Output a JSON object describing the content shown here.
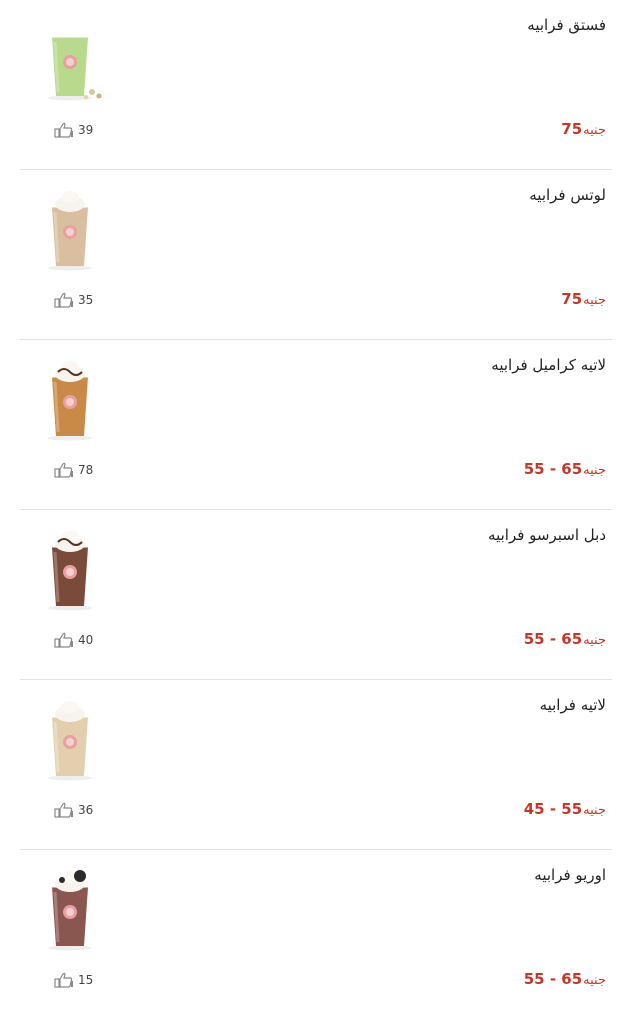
{
  "products": [
    {
      "name": "فستق فرابيه",
      "price_text": "75",
      "currency": "جنيه",
      "likes": "39",
      "image_icon": "pistachio-frappe-cup",
      "cup_color": "#b9d98d",
      "topping": "none"
    },
    {
      "name": "لوتس فرابيه",
      "price_text": "75",
      "currency": "جنيه",
      "likes": "35",
      "image_icon": "lotus-frappe-cup",
      "cup_color": "#d9bfa0",
      "topping": "cream"
    },
    {
      "name": "لاتيه كراميل فرابيه",
      "price_text": "55 - 65",
      "currency": "جنيه",
      "likes": "78",
      "image_icon": "caramel-latte-frappe-cup",
      "cup_color": "#c98a48",
      "topping": "cream-drizzle"
    },
    {
      "name": "دبل اسبرسو فرابيه",
      "price_text": "55 - 65",
      "currency": "جنيه",
      "likes": "40",
      "image_icon": "double-espresso-frappe-cup",
      "cup_color": "#7a4a3b",
      "topping": "cream-chocolate"
    },
    {
      "name": "لاتيه فرابيه",
      "price_text": "45 - 55",
      "currency": "جنيه",
      "likes": "36",
      "image_icon": "latte-frappe-cup",
      "cup_color": "#e3cfae",
      "topping": "cream"
    },
    {
      "name": "اوريو فرابيه",
      "price_text": "55 - 65",
      "currency": "جنيه",
      "likes": "15",
      "image_icon": "oreo-frappe-cup",
      "cup_color": "#8a5650",
      "topping": "cream-oreo"
    }
  ],
  "colors": {
    "price": "#c0392b",
    "divider": "#e3e3e3",
    "logo_badge": "#e8a0a0"
  }
}
